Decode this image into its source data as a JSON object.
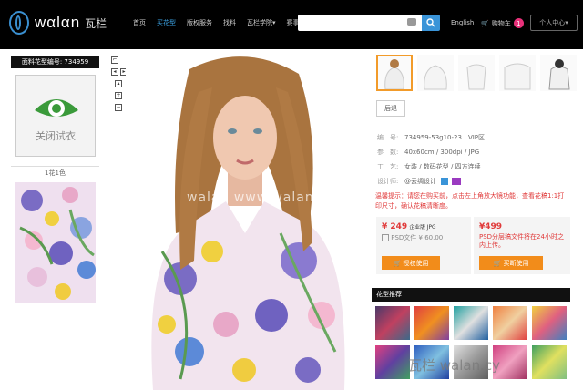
{
  "header": {
    "logo": "wαlαn",
    "logo_cn": "瓦栏",
    "nav": [
      "首页",
      "买花型",
      "版权服务",
      "找料",
      "瓦栏学院▾",
      "赛事活动▾"
    ],
    "lang": "English",
    "cart_label": "购物车",
    "cart_count": "1",
    "user_label": "个人中心▾"
  },
  "left": {
    "code_label": "面料花型编号: 734959",
    "tryon_label": "关闭试衣",
    "color_count": "1花1色"
  },
  "watermark": "walan www.walan.com",
  "detail": {
    "back": "后退",
    "rows": [
      {
        "k": "编　号:",
        "v": "734959-53g10-23　VIP区"
      },
      {
        "k": "参　数:",
        "v": "40x60cm / 300dpi / JPG"
      },
      {
        "k": "工　艺:",
        "v": "女装 / 数码花型 / 四方连续"
      },
      {
        "k": "设计师:",
        "v": "@云绸设计"
      }
    ],
    "tip": "温馨提示：请您在购买前，点击左上角放大镜功能，查看花稿1:1打印尺寸，确认花稿清晰度。",
    "price1": {
      "price": "¥ 249",
      "unit": "企业版 JPG",
      "sub": "PSD文件 ¥ 60.00",
      "btn": "授权使用"
    },
    "price2": {
      "price": "¥499",
      "desc": "PSD分层稿文件将在24小时之内上传。",
      "btn": "买断使用"
    },
    "rec_title": "花型推荐",
    "wm2": "瓦栏 walan.cy"
  },
  "colors": {
    "accent": "#3a94d8",
    "orange": "#f28c1a",
    "red": "#e03a3a",
    "badge": "#e8317a"
  }
}
